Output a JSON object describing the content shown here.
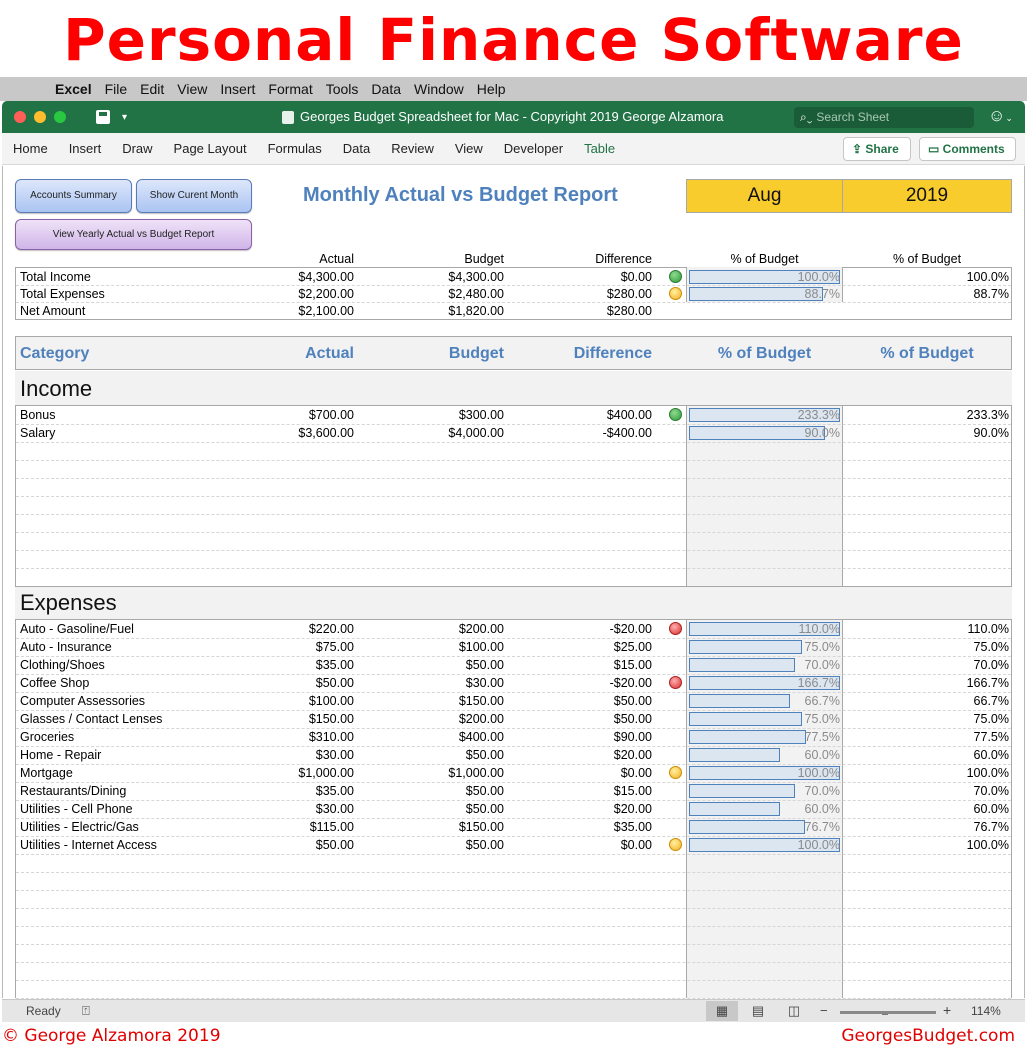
{
  "banner": {
    "title": "Personal Finance Software"
  },
  "menubar": {
    "app": "Excel",
    "items": [
      "File",
      "Edit",
      "View",
      "Insert",
      "Format",
      "Tools",
      "Data",
      "Window",
      "Help"
    ]
  },
  "window": {
    "title": "Georges Budget Spreadsheet for Mac - Copyright 2019 George Alzamora",
    "search_placeholder": "Search Sheet"
  },
  "ribbon": {
    "tabs": [
      "Home",
      "Insert",
      "Draw",
      "Page Layout",
      "Formulas",
      "Data",
      "Review",
      "View",
      "Developer",
      "Table"
    ],
    "active_tab": "Table",
    "share": "Share",
    "comments": "Comments"
  },
  "buttons": {
    "accounts_summary": "Accounts Summary",
    "show_current_month": "Show Curent Month",
    "view_yearly": "View Yearly Actual vs Budget Report"
  },
  "report": {
    "title": "Monthly Actual vs Budget Report",
    "month": "Aug",
    "year": "2019"
  },
  "summary": {
    "headers": {
      "actual": "Actual",
      "budget": "Budget",
      "difference": "Difference",
      "pct1": "% of Budget",
      "pct2": "% of Budget"
    },
    "rows": [
      {
        "label": "Total Income",
        "actual": "$4,300.00",
        "budget": "$4,300.00",
        "diff": "$0.00",
        "indicator": "green",
        "pct": 100.0,
        "pct_text": "100.0%"
      },
      {
        "label": "Total Expenses",
        "actual": "$2,200.00",
        "budget": "$2,480.00",
        "diff": "$280.00",
        "indicator": "yellow",
        "pct": 88.7,
        "pct_text": "88.7%"
      },
      {
        "label": "Net Amount",
        "actual": "$2,100.00",
        "budget": "$1,820.00",
        "diff": "$280.00",
        "indicator": "",
        "pct": null,
        "pct_text": ""
      }
    ]
  },
  "table": {
    "headers": {
      "category": "Category",
      "actual": "Actual",
      "budget": "Budget",
      "difference": "Difference",
      "pct1": "% of Budget",
      "pct2": "% of Budget"
    }
  },
  "income": {
    "title": "Income",
    "rows": [
      {
        "label": "Bonus",
        "actual": "$700.00",
        "budget": "$300.00",
        "diff": "$400.00",
        "indicator": "green",
        "pct": 233.3,
        "pct_text": "233.3%"
      },
      {
        "label": "Salary",
        "actual": "$3,600.00",
        "budget": "$4,000.00",
        "diff": "-$400.00",
        "indicator": "",
        "pct": 90.0,
        "pct_text": "90.0%"
      }
    ]
  },
  "expenses": {
    "title": "Expenses",
    "rows": [
      {
        "label": "Auto - Gasoline/Fuel",
        "actual": "$220.00",
        "budget": "$200.00",
        "diff": "-$20.00",
        "indicator": "red",
        "pct": 110.0,
        "pct_text": "110.0%"
      },
      {
        "label": "Auto - Insurance",
        "actual": "$75.00",
        "budget": "$100.00",
        "diff": "$25.00",
        "indicator": "",
        "pct": 75.0,
        "pct_text": "75.0%"
      },
      {
        "label": "Clothing/Shoes",
        "actual": "$35.00",
        "budget": "$50.00",
        "diff": "$15.00",
        "indicator": "",
        "pct": 70.0,
        "pct_text": "70.0%"
      },
      {
        "label": "Coffee Shop",
        "actual": "$50.00",
        "budget": "$30.00",
        "diff": "-$20.00",
        "indicator": "red",
        "pct": 166.7,
        "pct_text": "166.7%"
      },
      {
        "label": "Computer Assessories",
        "actual": "$100.00",
        "budget": "$150.00",
        "diff": "$50.00",
        "indicator": "",
        "pct": 66.7,
        "pct_text": "66.7%"
      },
      {
        "label": "Glasses / Contact Lenses",
        "actual": "$150.00",
        "budget": "$200.00",
        "diff": "$50.00",
        "indicator": "",
        "pct": 75.0,
        "pct_text": "75.0%"
      },
      {
        "label": "Groceries",
        "actual": "$310.00",
        "budget": "$400.00",
        "diff": "$90.00",
        "indicator": "",
        "pct": 77.5,
        "pct_text": "77.5%"
      },
      {
        "label": "Home - Repair",
        "actual": "$30.00",
        "budget": "$50.00",
        "diff": "$20.00",
        "indicator": "",
        "pct": 60.0,
        "pct_text": "60.0%"
      },
      {
        "label": "Mortgage",
        "actual": "$1,000.00",
        "budget": "$1,000.00",
        "diff": "$0.00",
        "indicator": "yellow",
        "pct": 100.0,
        "pct_text": "100.0%"
      },
      {
        "label": "Restaurants/Dining",
        "actual": "$35.00",
        "budget": "$50.00",
        "diff": "$15.00",
        "indicator": "",
        "pct": 70.0,
        "pct_text": "70.0%"
      },
      {
        "label": "Utilities - Cell Phone",
        "actual": "$30.00",
        "budget": "$50.00",
        "diff": "$20.00",
        "indicator": "",
        "pct": 60.0,
        "pct_text": "60.0%"
      },
      {
        "label": "Utilities - Electric/Gas",
        "actual": "$115.00",
        "budget": "$150.00",
        "diff": "$35.00",
        "indicator": "",
        "pct": 76.7,
        "pct_text": "76.7%"
      },
      {
        "label": "Utilities - Internet Access",
        "actual": "$50.00",
        "budget": "$50.00",
        "diff": "$0.00",
        "indicator": "yellow",
        "pct": 100.0,
        "pct_text": "100.0%"
      }
    ]
  },
  "statusbar": {
    "status": "Ready",
    "zoom": "114%",
    "zoom_fraction": 0.47
  },
  "footer": {
    "left": "© George Alzamora 2019",
    "right": "GeorgesBudget.com"
  }
}
